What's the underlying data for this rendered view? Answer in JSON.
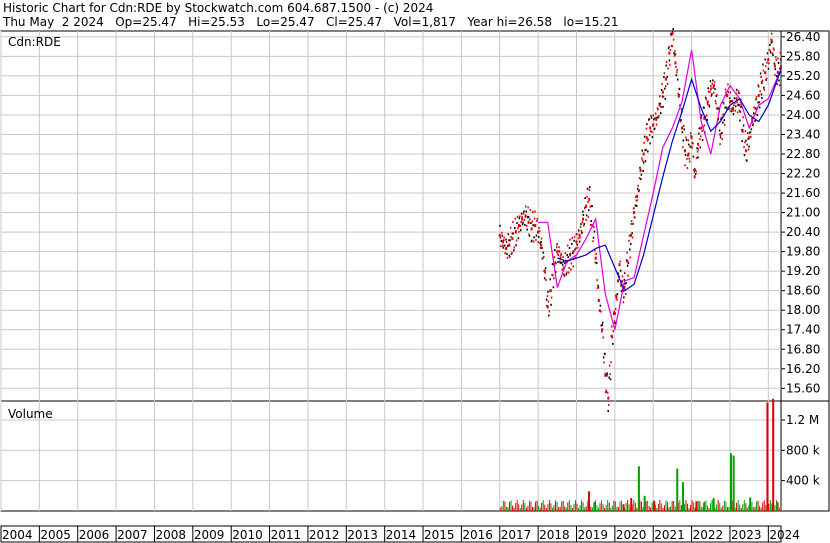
{
  "header": {
    "line1": "Historic Chart for Cdn:RDE by Stockwatch.com 604.687.1500 - (c) 2024",
    "line2": "Thu May  2 2024   Op=25.47   Hi=25.53   Lo=25.47   Cl=25.47   Vol=1,817   Year hi=26.58   lo=15.21"
  },
  "colors": {
    "price_up": "#000000",
    "price_down": "#e00000",
    "ma_short": "#e000e0",
    "ma_long": "#0000d0",
    "vol_up": "#00a000",
    "vol_down": "#e00000",
    "grid": "#c8c8c8"
  },
  "chart_data": [
    {
      "type": "scatter",
      "title": "Cdn:RDE",
      "ylim": [
        15.21,
        26.58
      ],
      "y_ticks": [
        "15.60",
        "16.20",
        "16.80",
        "17.40",
        "18.00",
        "18.60",
        "19.20",
        "19.80",
        "20.40",
        "21.00",
        "21.60",
        "22.20",
        "22.80",
        "23.40",
        "24.00",
        "24.60",
        "25.20",
        "25.80",
        "26.40"
      ],
      "x_tick_labels": [
        "2004",
        "2005",
        "2006",
        "2007",
        "2008",
        "2009",
        "2010",
        "2011",
        "2012",
        "2013",
        "2014",
        "2015",
        "2016",
        "2017",
        "2018",
        "2019",
        "2020",
        "2021",
        "2022",
        "2023",
        "2024"
      ],
      "grid": true,
      "series": [
        {
          "kind": "price",
          "x": [
            2017.0,
            2017.08,
            2017.17,
            2017.25,
            2017.33,
            2017.42,
            2017.5,
            2017.58,
            2017.67,
            2017.75,
            2017.83,
            2017.92,
            2018.0,
            2018.08,
            2018.17,
            2018.25,
            2018.33,
            2018.42,
            2018.5,
            2018.58,
            2018.67,
            2018.75,
            2018.83,
            2018.92,
            2019.0,
            2019.08,
            2019.17,
            2019.25,
            2019.33,
            2019.42,
            2019.5,
            2019.58,
            2019.67,
            2019.75,
            2019.83,
            2019.92,
            2020.0,
            2020.04,
            2020.08,
            2020.12,
            2020.17,
            2020.21,
            2020.25,
            2020.33,
            2020.42,
            2020.5,
            2020.58,
            2020.67,
            2020.75,
            2020.83,
            2020.92,
            2021.0,
            2021.08,
            2021.17,
            2021.25,
            2021.33,
            2021.42,
            2021.5,
            2021.58,
            2021.67,
            2021.75,
            2021.83,
            2021.92,
            2022.0,
            2022.08,
            2022.17,
            2022.25,
            2022.33,
            2022.42,
            2022.5,
            2022.58,
            2022.67,
            2022.75,
            2022.83,
            2022.92,
            2023.0,
            2023.08,
            2023.17,
            2023.25,
            2023.33,
            2023.42,
            2023.5,
            2023.58,
            2023.67,
            2023.75,
            2023.83,
            2023.92,
            2024.0,
            2024.08,
            2024.17,
            2024.25,
            2024.33
          ],
          "y": [
            20.3,
            20.1,
            19.9,
            20.0,
            20.2,
            20.4,
            20.6,
            20.8,
            20.9,
            20.7,
            20.5,
            20.6,
            20.4,
            20.0,
            19.2,
            18.1,
            18.6,
            19.4,
            19.8,
            19.6,
            19.3,
            19.5,
            19.7,
            19.8,
            20.1,
            20.3,
            20.8,
            21.2,
            21.4,
            20.6,
            19.6,
            18.3,
            17.4,
            16.0,
            15.3,
            17.2,
            17.9,
            18.4,
            18.9,
            19.4,
            18.8,
            18.6,
            18.7,
            19.5,
            20.3,
            21.0,
            21.5,
            22.3,
            22.8,
            23.3,
            23.6,
            23.7,
            23.9,
            24.3,
            24.7,
            25.1,
            25.9,
            26.5,
            25.6,
            24.6,
            23.6,
            22.9,
            22.8,
            23.3,
            22.1,
            23.1,
            23.6,
            23.9,
            24.4,
            24.8,
            24.9,
            24.2,
            23.4,
            24.0,
            24.6,
            24.4,
            24.2,
            24.5,
            24.3,
            23.5,
            22.9,
            23.3,
            23.8,
            24.2,
            24.6,
            25.0,
            25.3,
            25.7,
            26.3,
            25.5,
            25.3,
            25.47
          ]
        },
        {
          "kind": "ma_short",
          "x": [
            2018.0,
            2018.25,
            2018.5,
            2018.75,
            2019.0,
            2019.25,
            2019.5,
            2019.75,
            2020.0,
            2020.25,
            2020.5,
            2020.75,
            2021.0,
            2021.25,
            2021.5,
            2021.75,
            2022.0,
            2022.25,
            2022.5,
            2022.75,
            2023.0,
            2023.25,
            2023.5,
            2023.75,
            2024.0,
            2024.33
          ],
          "y": [
            20.7,
            20.7,
            18.7,
            19.5,
            19.7,
            20.2,
            20.8,
            18.5,
            17.4,
            18.9,
            19.0,
            20.3,
            21.6,
            23.0,
            23.6,
            24.4,
            26.0,
            23.8,
            22.8,
            24.3,
            24.9,
            24.5,
            23.6,
            24.3,
            24.5,
            25.4
          ]
        },
        {
          "kind": "ma_long",
          "x": [
            2018.5,
            2018.75,
            2019.0,
            2019.25,
            2019.5,
            2019.75,
            2020.0,
            2020.25,
            2020.5,
            2020.75,
            2021.0,
            2021.25,
            2021.5,
            2021.75,
            2022.0,
            2022.25,
            2022.5,
            2022.75,
            2023.0,
            2023.25,
            2023.5,
            2023.75,
            2024.0,
            2024.33
          ],
          "y": [
            19.6,
            19.5,
            19.6,
            19.7,
            19.9,
            20.0,
            19.3,
            18.6,
            18.8,
            19.7,
            20.9,
            22.1,
            23.2,
            24.1,
            25.1,
            24.2,
            23.5,
            23.8,
            24.3,
            24.5,
            24.0,
            23.8,
            24.3,
            25.4
          ]
        }
      ]
    },
    {
      "type": "bar",
      "title": "Volume",
      "ylim": [
        0,
        1450000
      ],
      "y_ticks": [
        "400 k",
        "800 k",
        "1.2 M"
      ],
      "y_tick_values": [
        400000,
        800000,
        1200000
      ],
      "bars": [
        {
          "x": 2019.3,
          "value": 260000,
          "dir": "down"
        },
        {
          "x": 2019.45,
          "value": 120000,
          "dir": "up"
        },
        {
          "x": 2020.2,
          "value": 90000,
          "dir": "down"
        },
        {
          "x": 2020.4,
          "value": 170000,
          "dir": "down"
        },
        {
          "x": 2020.6,
          "value": 590000,
          "dir": "up"
        },
        {
          "x": 2020.75,
          "value": 200000,
          "dir": "up"
        },
        {
          "x": 2021.0,
          "value": 130000,
          "dir": "down"
        },
        {
          "x": 2021.6,
          "value": 560000,
          "dir": "up"
        },
        {
          "x": 2021.75,
          "value": 380000,
          "dir": "up"
        },
        {
          "x": 2022.1,
          "value": 130000,
          "dir": "down"
        },
        {
          "x": 2022.3,
          "value": 110000,
          "dir": "up"
        },
        {
          "x": 2022.55,
          "value": 170000,
          "dir": "up"
        },
        {
          "x": 2023.0,
          "value": 760000,
          "dir": "up"
        },
        {
          "x": 2023.07,
          "value": 730000,
          "dir": "up"
        },
        {
          "x": 2023.5,
          "value": 180000,
          "dir": "up"
        },
        {
          "x": 2023.95,
          "value": 1430000,
          "dir": "down"
        },
        {
          "x": 2024.1,
          "value": 1480000,
          "dir": "down"
        },
        {
          "x": 2024.2,
          "value": 120000,
          "dir": "up"
        }
      ]
    }
  ]
}
